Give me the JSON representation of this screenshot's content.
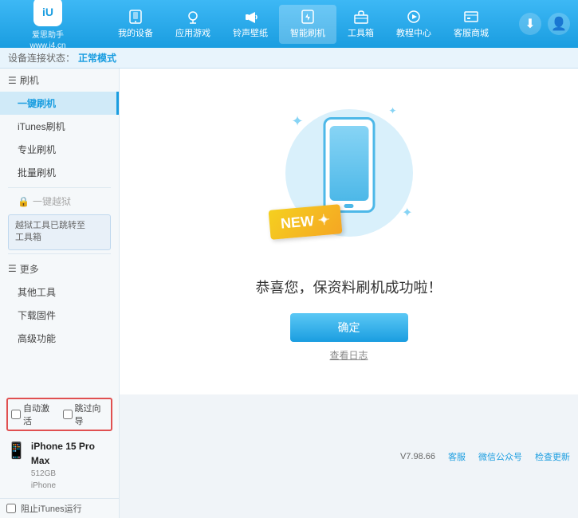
{
  "header": {
    "logo_line1": "爱思助手",
    "logo_line2": "www.i4.cn",
    "logo_text": "iU",
    "nav": [
      {
        "id": "my-device",
        "label": "我的设备",
        "icon": "📱"
      },
      {
        "id": "app-games",
        "label": "应用游戏",
        "icon": "👤"
      },
      {
        "id": "ringtone",
        "label": "铃声壁纸",
        "icon": "🔔"
      },
      {
        "id": "smart-flash",
        "label": "智能刷机",
        "icon": "🔄"
      },
      {
        "id": "toolbox",
        "label": "工具箱",
        "icon": "💼"
      },
      {
        "id": "tutorial",
        "label": "教程中心",
        "icon": "🎓"
      },
      {
        "id": "service",
        "label": "客服商城",
        "icon": "🖥️"
      }
    ]
  },
  "status_bar": {
    "prefix": "设备连接状态：",
    "mode": "正常模式"
  },
  "sidebar": {
    "section_flash": "刷机",
    "items": [
      {
        "id": "one-click-flash",
        "label": "一键刷机",
        "active": true
      },
      {
        "id": "itunes-flash",
        "label": "iTunes刷机",
        "active": false
      },
      {
        "id": "pro-flash",
        "label": "专业刷机",
        "active": false
      },
      {
        "id": "batch-flash",
        "label": "批量刷机",
        "active": false
      }
    ],
    "disabled_label": "一键越狱",
    "notice": "越狱工具已跳转至\n工具箱",
    "section_more": "更多",
    "more_items": [
      {
        "id": "other-tools",
        "label": "其他工具"
      },
      {
        "id": "download-firmware",
        "label": "下载固件"
      },
      {
        "id": "advanced",
        "label": "高级功能"
      }
    ]
  },
  "content": {
    "new_badge": "NEW",
    "success_text": "恭喜您，保资料刷机成功啦！",
    "confirm_btn": "确定",
    "log_link": "查看日志"
  },
  "device_panel": {
    "auto_activate_label": "自动激活",
    "guide_label": "跳过向导",
    "device_name": "iPhone 15 Pro Max",
    "storage": "512GB",
    "type": "iPhone"
  },
  "itunes_bar": {
    "label": "阻止iTunes运行"
  },
  "bottom_bar": {
    "version": "V7.98.66",
    "links": [
      "客服",
      "微信公众号",
      "检查更新"
    ]
  }
}
